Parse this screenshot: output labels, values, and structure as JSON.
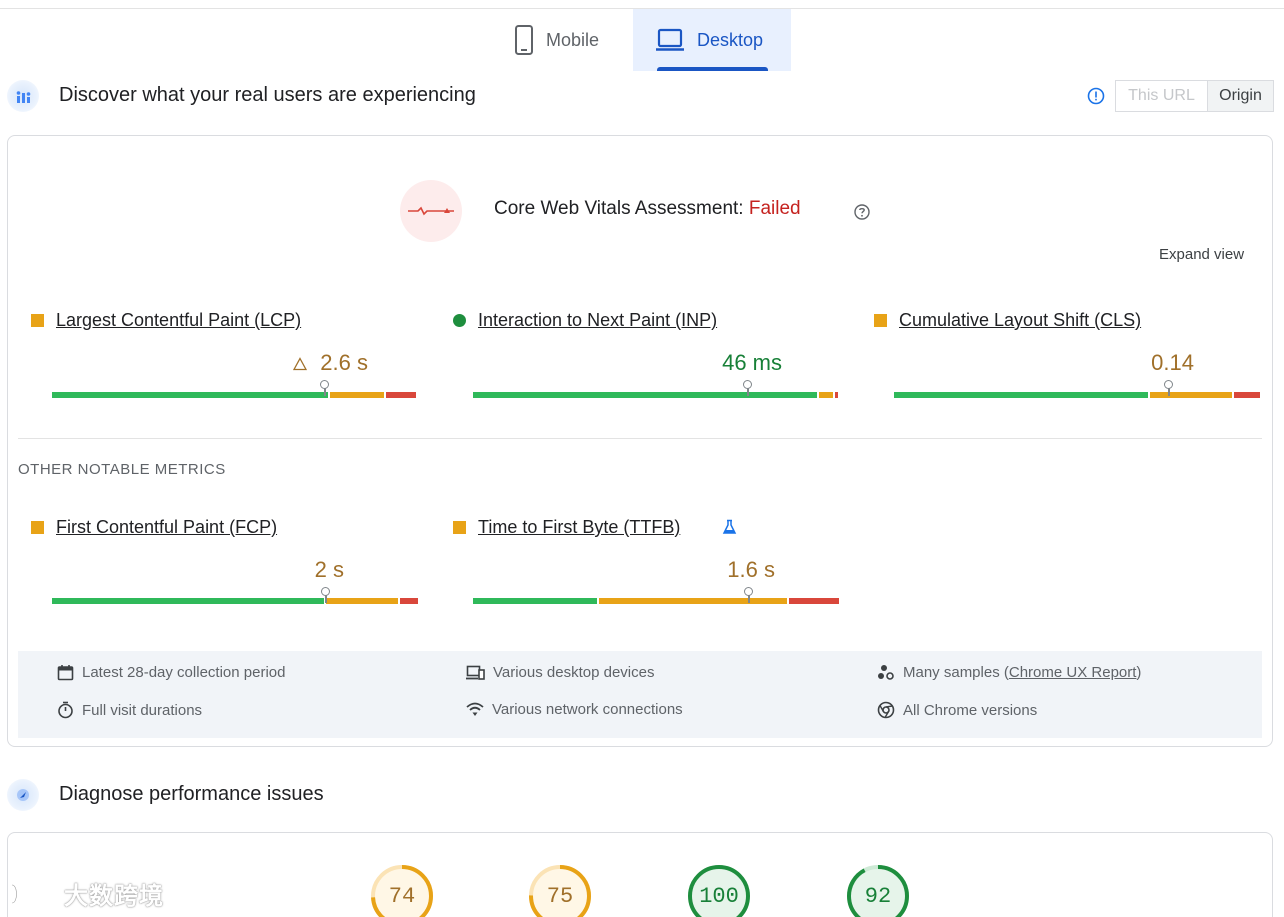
{
  "tabs": [
    {
      "label": "Mobile",
      "icon": "phone-icon",
      "active": false
    },
    {
      "label": "Desktop",
      "icon": "laptop-icon",
      "active": true
    }
  ],
  "field_section": {
    "title": "Discover what your real users are experiencing",
    "icon": "users-chart-icon",
    "toggle": {
      "this_url": "This URL",
      "origin": "Origin",
      "selected": "Origin"
    }
  },
  "assessment": {
    "label": "Core Web Vitals Assessment: ",
    "status": "Failed",
    "status_color": "#c5221f",
    "expand_label": "Expand view"
  },
  "core_metrics": [
    {
      "name": "Largest Contentful Paint (LCP)",
      "value": "2.6 s",
      "rating": "needs-improvement",
      "warning_icon": true
    },
    {
      "name": "Interaction to Next Paint (INP)",
      "value": "46 ms",
      "rating": "good",
      "warning_icon": false
    },
    {
      "name": "Cumulative Layout Shift (CLS)",
      "value": "0.14",
      "rating": "needs-improvement",
      "warning_icon": false
    }
  ],
  "other_label": "OTHER NOTABLE METRICS",
  "other_metrics": [
    {
      "name": "First Contentful Paint (FCP)",
      "value": "2 s",
      "rating": "needs-improvement"
    },
    {
      "name": "Time to First Byte (TTFB)",
      "value": "1.6 s",
      "rating": "needs-improvement",
      "experimental_icon": "flask-icon"
    }
  ],
  "info": {
    "period": "Latest 28-day collection period",
    "durations": "Full visit durations",
    "devices": "Various desktop devices",
    "network": "Various network connections",
    "samples_prefix": "Many samples (",
    "samples_link": "Chrome UX Report",
    "samples_suffix": ")",
    "versions": "All Chrome versions"
  },
  "diagnose": {
    "title": "Diagnose performance issues",
    "icon": "diagnose-icon",
    "scores": [
      {
        "value": "74",
        "color": "#e8a317"
      },
      {
        "value": "75",
        "color": "#e8a317"
      },
      {
        "value": "100",
        "color": "#1e8e3e"
      },
      {
        "value": "92",
        "color": "#1e8e3e"
      }
    ]
  },
  "watermark": "大数跨境",
  "colors": {
    "good": "#2fb95a",
    "average": "#e8a317",
    "poor": "#d9473b",
    "accent": "#1a56c4"
  }
}
